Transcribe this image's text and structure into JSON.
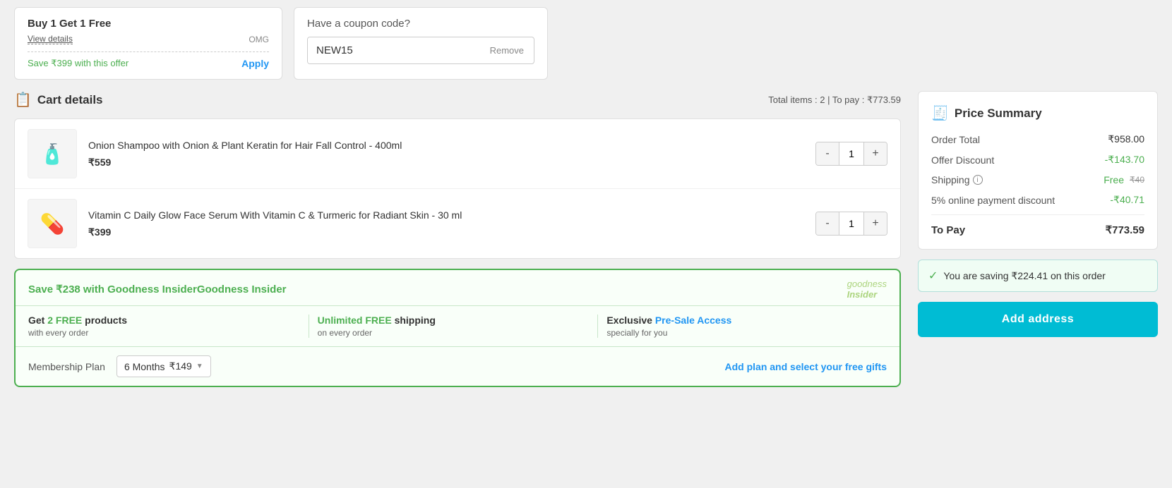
{
  "topSection": {
    "offerCard": {
      "title": "Buy 1 Get 1 Free",
      "viewDetails": "View details",
      "badge": "OMG",
      "saveText": "Save ₹399 with this offer",
      "applyBtn": "Apply"
    },
    "couponCard": {
      "title": "Have a coupon code?",
      "couponValue": "NEW15",
      "removeBtn": "Remove"
    }
  },
  "cartSection": {
    "title": "Cart details",
    "totalItems": "Total items : 2 | To pay : ₹773.59",
    "items": [
      {
        "name": "Onion Shampoo with Onion & Plant Keratin for Hair Fall Control - 400ml",
        "price": "₹559",
        "quantity": 1,
        "emoji": "🧴"
      },
      {
        "name": "Vitamin C Daily Glow Face Serum With Vitamin C & Turmeric for Radiant Skin - 30 ml",
        "price": "₹399",
        "quantity": 1,
        "emoji": "💊"
      }
    ]
  },
  "insiderSection": {
    "saveText": "Save ₹238 with",
    "brandName": "Goodness Insider",
    "logoText": "goodness Insider",
    "features": [
      {
        "title1": "Get ",
        "highlight1": "2 FREE",
        "title2": " products",
        "sub": "with every order"
      },
      {
        "title1": "",
        "highlight1": "Unlimited FREE",
        "title2": " shipping",
        "sub": "on every order"
      },
      {
        "title1": "Exclusive ",
        "highlight1": "Pre-Sale Access",
        "title2": "",
        "sub": "specially for you"
      }
    ],
    "membershipLabel": "Membership Plan",
    "planLabel": "6 Months",
    "planPrice": "₹149",
    "addPlanText": "Add plan and select your free gifts"
  },
  "priceSummary": {
    "title": "Price Summary",
    "rows": [
      {
        "label": "Order Total",
        "value": "₹958.00",
        "type": "normal"
      },
      {
        "label": "Offer Discount",
        "value": "-₹143.70",
        "type": "discount"
      },
      {
        "label": "Shipping",
        "valueFree": "Free",
        "valueStrike": "₹40",
        "type": "shipping"
      },
      {
        "label": "5% online payment discount",
        "value": "-₹40.71",
        "type": "discount"
      }
    ],
    "total": {
      "label": "To Pay",
      "value": "₹773.59"
    }
  },
  "savingBanner": {
    "text": "You are saving ₹224.41 on this order"
  },
  "addAddressBtn": "Add address"
}
